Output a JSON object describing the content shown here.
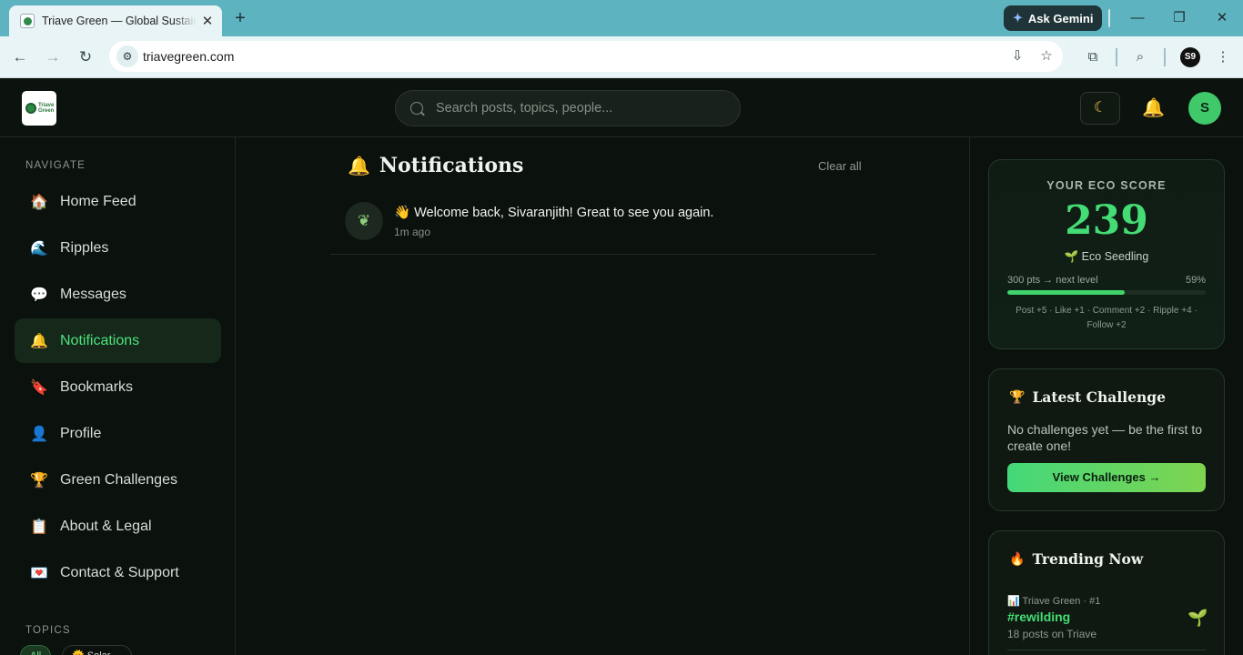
{
  "browser": {
    "tab_title": "Triave Green — Global Sustainability Network",
    "new_tab": "+",
    "gemini_label": "Ask Gemini",
    "url": "triavegreen.com",
    "profile_initials": "S9"
  },
  "app": {
    "logo_text": "Triave Green",
    "search_placeholder": "Search posts, topics, people...",
    "avatar_initial": "S"
  },
  "sidebar": {
    "nav_heading": "NAVIGATE",
    "items": [
      {
        "icon": "🏠",
        "label": "Home Feed"
      },
      {
        "icon": "🌊",
        "label": "Ripples"
      },
      {
        "icon": "💬",
        "label": "Messages"
      },
      {
        "icon": "🔔",
        "label": "Notifications"
      },
      {
        "icon": "🔖",
        "label": "Bookmarks"
      },
      {
        "icon": "👤",
        "label": "Profile"
      },
      {
        "icon": "🏆",
        "label": "Green Challenges"
      },
      {
        "icon": "📋",
        "label": "About & Legal"
      },
      {
        "icon": "💌",
        "label": "Contact & Support"
      }
    ],
    "topics_heading": "TOPICS",
    "topic_chips": [
      "All",
      "🌞 Solar ..."
    ]
  },
  "main": {
    "title": "Notifications",
    "clear_all": "Clear all",
    "notifications": [
      {
        "text": "👋 Welcome back, Sivaranjith! Great to see you again.",
        "time": "1m ago"
      }
    ]
  },
  "eco_score": {
    "heading": "YOUR ECO SCORE",
    "score": "239",
    "level": "🌱 Eco Seedling",
    "next_level": "300 pts → next level",
    "progress_percent": 59,
    "progress_label": "59%",
    "rules": "Post +5 · Like +1 · Comment +2 · Ripple +4 · Follow +2"
  },
  "challenge": {
    "title": "Latest Challenge",
    "empty_text": "No challenges yet — be the first to create one!",
    "button": "View Challenges →"
  },
  "trending": {
    "title": "Trending Now",
    "items": [
      {
        "meta": "📊 Triave Green · #1",
        "tag": "#rewilding",
        "count": "18 posts on Triave"
      }
    ]
  },
  "colors": {
    "accent": "#44dc75",
    "background": "#0b110d",
    "browser_frame": "#5db3bf"
  }
}
